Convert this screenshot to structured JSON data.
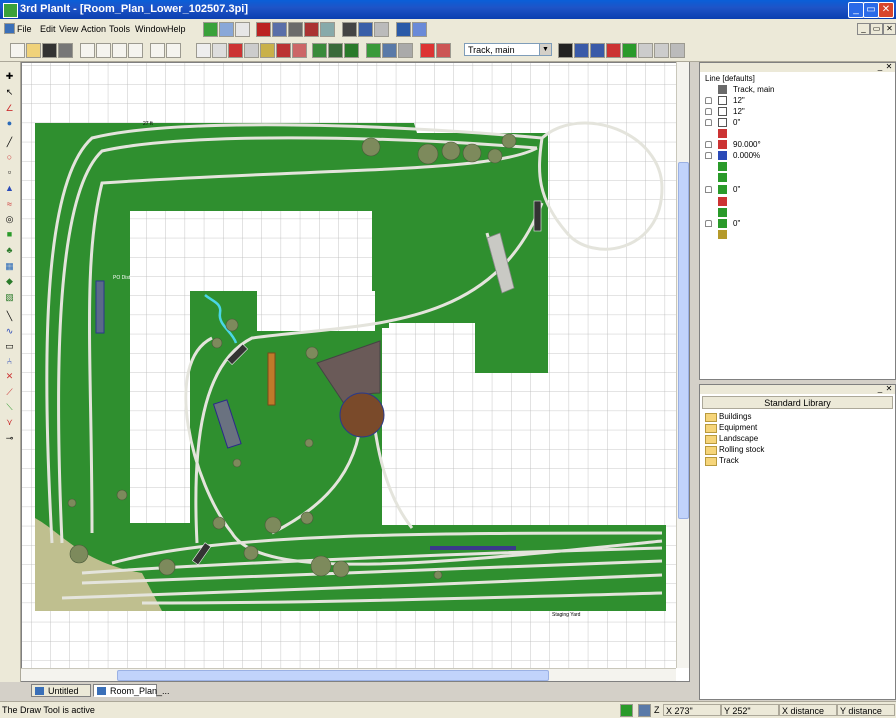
{
  "window": {
    "app_title": "3rd PlanIt - [Room_Plan_Lower_102507.3pi]",
    "minimize_icon": "minimize-icon",
    "maximize_icon": "restore-icon",
    "close_icon": "close-icon"
  },
  "menu": {
    "items": [
      "File",
      "Edit",
      "View",
      "Action",
      "Tools",
      "Window",
      "Help"
    ]
  },
  "toolbar": {
    "track_select_value": "Track, main"
  },
  "canvas": {
    "labels": {
      "top_label": "27 ft",
      "po_label": "PO Dist",
      "staging_label": "Staging Yard"
    }
  },
  "tabs": {
    "items": [
      {
        "label": "Untitled"
      },
      {
        "label": "Room_Plan_..."
      }
    ]
  },
  "properties": {
    "heading": "Line [defaults]",
    "rows": [
      {
        "icon": "layer-icon",
        "value": "Track, main"
      },
      {
        "icon": "width-icon",
        "value": "12\""
      },
      {
        "icon": "dx-icon",
        "value": "12\""
      },
      {
        "icon": "dy-icon",
        "value": "0\""
      },
      {
        "icon": "angle-icon",
        "value": ""
      },
      {
        "icon": "rotation-icon",
        "value": "90.000°"
      },
      {
        "icon": "grade-icon",
        "value": "0.000%"
      },
      {
        "icon": "elevation-start-icon",
        "value": ""
      },
      {
        "icon": "elevation-end-icon",
        "value": ""
      },
      {
        "icon": "height-start-icon",
        "value": "0\""
      },
      {
        "icon": "height-mid-icon",
        "value": ""
      },
      {
        "icon": "height-end-icon",
        "value": ""
      },
      {
        "icon": "height-z-icon",
        "value": "0\""
      },
      {
        "icon": "slope-icon",
        "value": ""
      }
    ]
  },
  "library": {
    "title": "Standard Library",
    "folders": [
      "Buildings",
      "Equipment",
      "Landscape",
      "Rolling stock",
      "Track"
    ]
  },
  "status": {
    "message": "The Draw Tool is active",
    "z_label": "Z",
    "x_coord": "X 273\"",
    "y_coord": "Y 252\"",
    "x_distance": "X distance",
    "y_distance": "Y distance"
  },
  "colors": {
    "grass": "#2f8f2f",
    "grid": "#b8b8b8",
    "track": "#e4e4dc",
    "trees": "#7d8a5c"
  }
}
